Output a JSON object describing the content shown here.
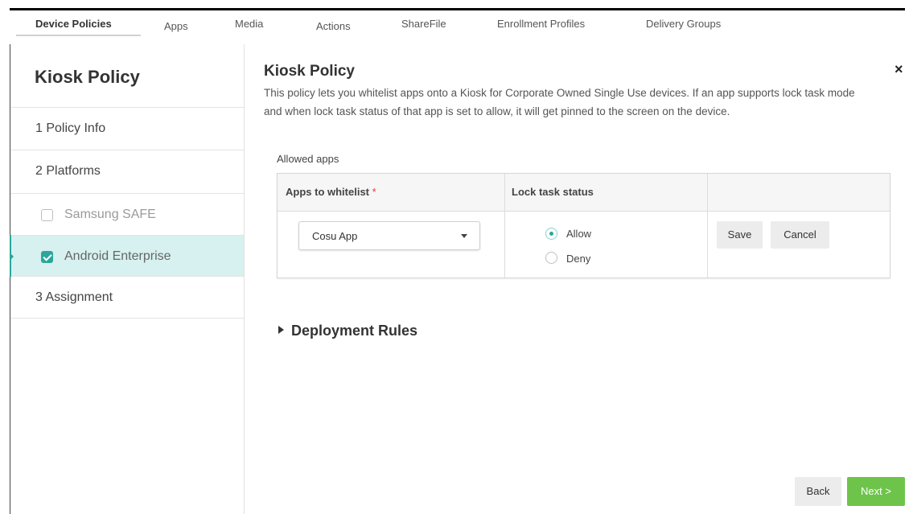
{
  "tabs": [
    {
      "label": "Device Policies",
      "active": true
    },
    {
      "label": "Apps"
    },
    {
      "label": "Media"
    },
    {
      "label": "Actions"
    },
    {
      "label": "ShareFile"
    },
    {
      "label": "Enrollment Profiles"
    },
    {
      "label": "Delivery Groups"
    }
  ],
  "sidebar": {
    "title": "Kiosk Policy",
    "items": [
      {
        "label": "1 Policy Info"
      },
      {
        "label": "2 Platforms"
      },
      {
        "label": "Samsung SAFE",
        "checked": false
      },
      {
        "label": "Android Enterprise",
        "checked": true,
        "active": true
      },
      {
        "label": "3 Assignment"
      }
    ]
  },
  "main": {
    "title": "Kiosk Policy",
    "close_icon": "close-icon",
    "description": "This policy lets you whitelist apps onto a Kiosk for Corporate Owned Single Use devices. If an app supports lock task mode and when lock task status of that app is set to allow, it will get pinned to the screen on the device.",
    "allowed_label": "Allowed apps",
    "table": {
      "headers": [
        "Apps to whitelist",
        "Lock task status",
        ""
      ],
      "required_mark": "*",
      "row": {
        "app": "Cosu App",
        "options": [
          "Allow",
          "Deny"
        ],
        "selected": "Allow",
        "save": "Save",
        "cancel": "Cancel"
      }
    },
    "deployment_rules": "Deployment Rules"
  },
  "footer": {
    "back": "Back",
    "next": "Next >"
  },
  "colors": {
    "accent": "#2ba69b",
    "active_bg": "#d6f1ef",
    "next_button": "#6ec44a"
  }
}
